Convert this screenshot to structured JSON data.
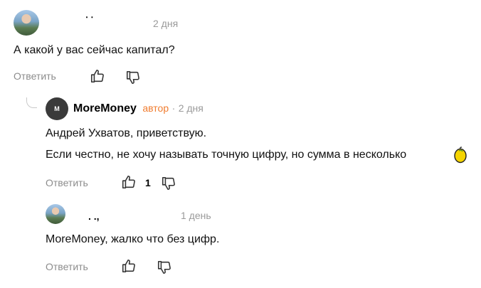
{
  "comments": [
    {
      "author": "․ ․",
      "time": "2 дня",
      "text": "А какой у вас сейчас капитал?",
      "reply_label": "Ответить"
    },
    {
      "author": "MoreMoney",
      "author_badge": "автор",
      "separator": "·",
      "time": "2 дня",
      "logo_text": "M",
      "line1": "Андрей Ухватов, приветствую.",
      "line2": "Если честно, не хочу называть точную цифру, но сумма в несколько",
      "reply_label": "Ответить",
      "like_count": "1"
    },
    {
      "author": ". .,",
      "time": "1 день",
      "text": "MoreMoney, жалко что без цифр.",
      "reply_label": "Ответить"
    }
  ],
  "icons": {
    "like": "thumbs-up-icon",
    "dislike": "thumbs-down-icon",
    "emoji": "lemon-emoji-icon",
    "thread": "thread-connector-icon"
  }
}
